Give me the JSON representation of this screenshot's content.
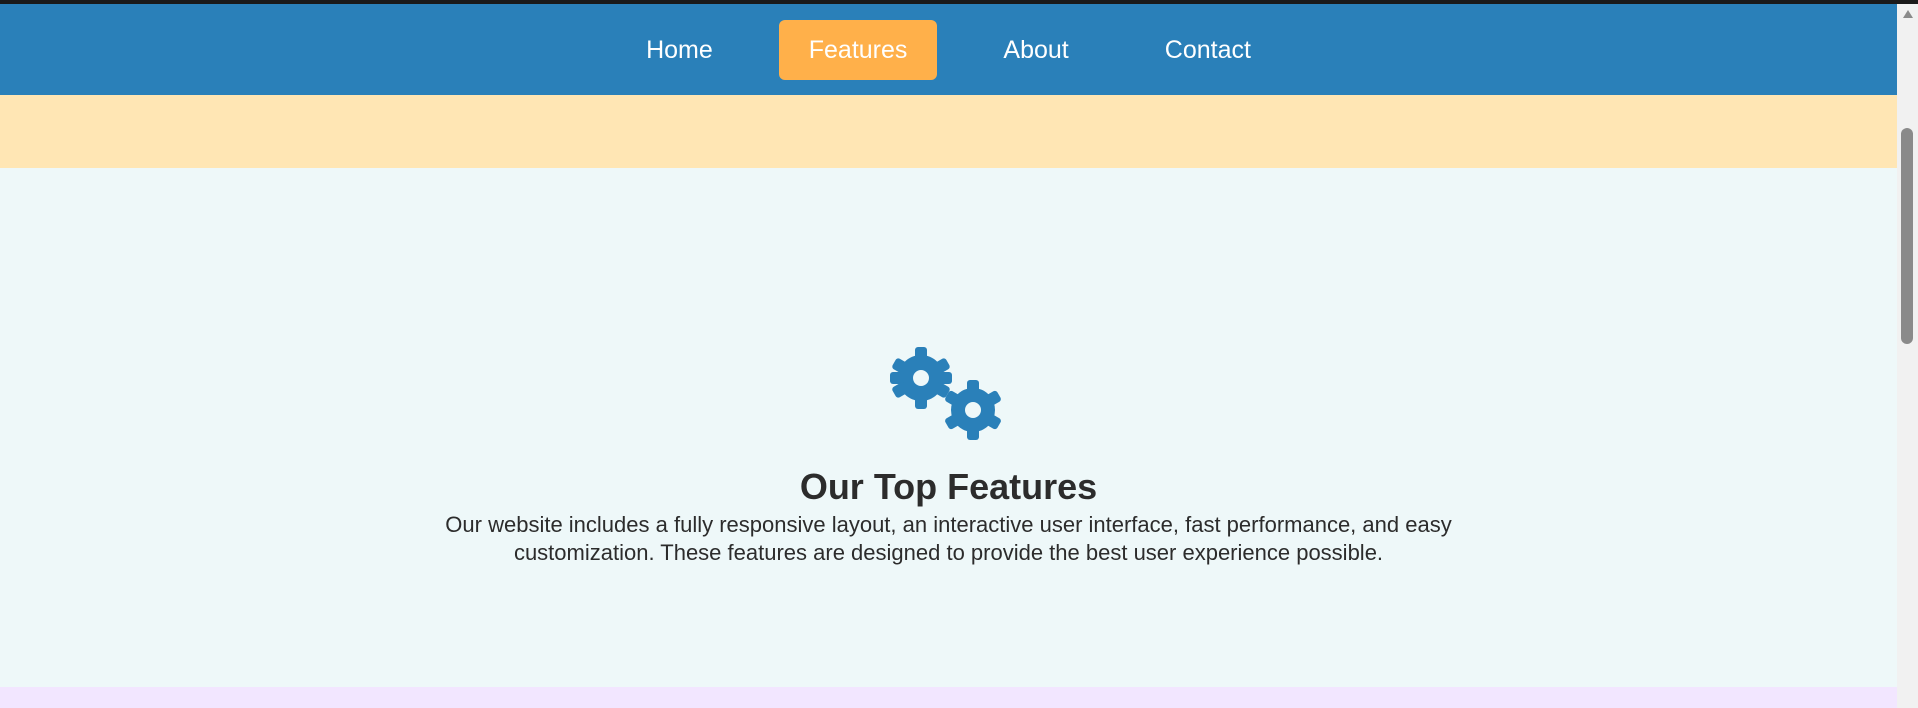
{
  "nav": {
    "items": [
      {
        "label": "Home",
        "active": false
      },
      {
        "label": "Features",
        "active": true
      },
      {
        "label": "About",
        "active": false
      },
      {
        "label": "Contact",
        "active": false
      }
    ]
  },
  "features": {
    "icon": "gears-icon",
    "title": "Our Top Features",
    "description": "Our website includes a fully responsive layout, an interactive user interface, fast performance, and easy customization. These features are designed to provide the best user experience possible."
  },
  "colors": {
    "navbar": "#2a80b9",
    "active_nav": "#ffb04a",
    "orange_band": "#ffe6b4",
    "section_bg": "#eef8f9",
    "lilac_band": "#f2e6ff",
    "icon": "#2a80b9"
  }
}
